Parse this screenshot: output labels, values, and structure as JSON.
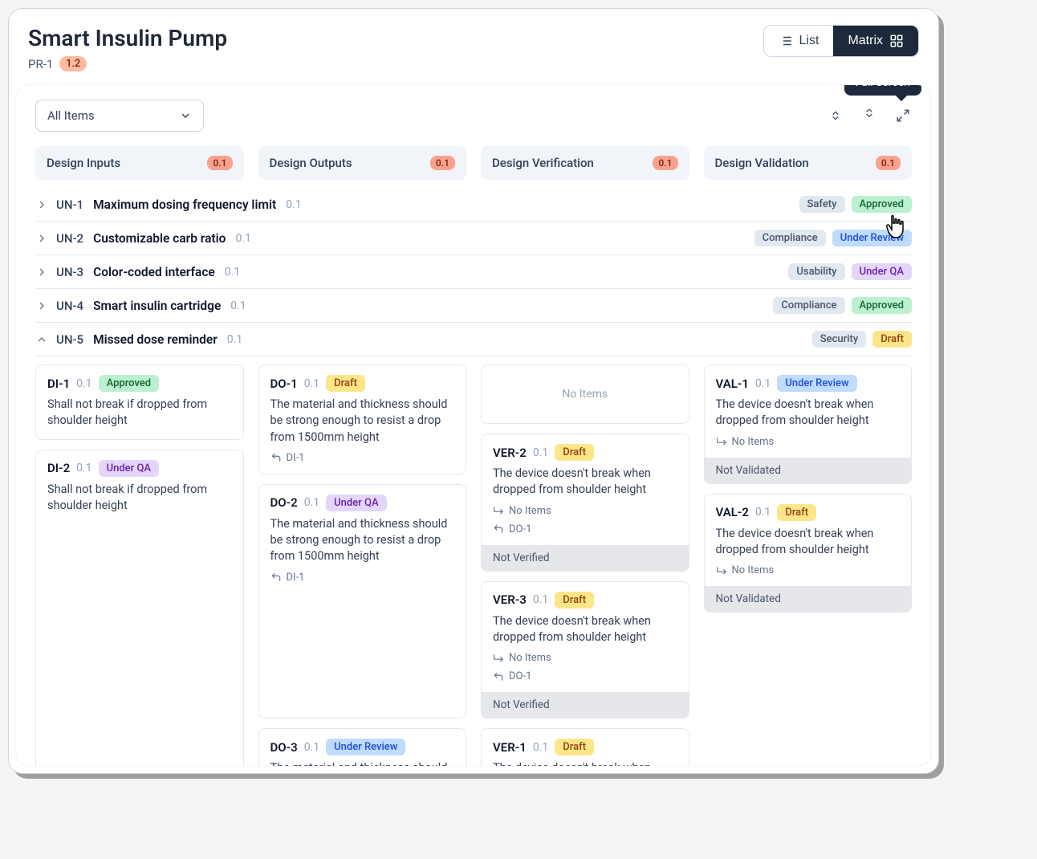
{
  "header": {
    "title": "Smart Insulin Pump",
    "project_id": "PR-1",
    "version": "1.2",
    "view_list": "List",
    "view_matrix": "Matrix"
  },
  "toolbar": {
    "filter_label": "All Items",
    "tooltip_fullscreen": "Full Screen"
  },
  "columns": [
    {
      "title": "Design Inputs",
      "count": "0.1"
    },
    {
      "title": "Design Outputs",
      "count": "0.1"
    },
    {
      "title": "Design Verification",
      "count": "0.1"
    },
    {
      "title": "Design Validation",
      "count": "0.1"
    }
  ],
  "rows": [
    {
      "id": "UN-1",
      "title": "Maximum dosing frequency limit",
      "ver": "0.1",
      "tag1": "Safety",
      "tag1_class": "tag-grey",
      "tag2": "Approved",
      "tag2_class": "tag-green",
      "expanded": false
    },
    {
      "id": "UN-2",
      "title": "Customizable carb ratio",
      "ver": "0.1",
      "tag1": "Compliance",
      "tag1_class": "tag-grey",
      "tag2": "Under Review",
      "tag2_class": "tag-blue",
      "expanded": false
    },
    {
      "id": "UN-3",
      "title": "Color-coded interface",
      "ver": "0.1",
      "tag1": "Usability",
      "tag1_class": "tag-grey",
      "tag2": "Under QA",
      "tag2_class": "tag-purple",
      "expanded": false
    },
    {
      "id": "UN-4",
      "title": "Smart insulin cartridge",
      "ver": "0.1",
      "tag1": "Compliance",
      "tag1_class": "tag-grey",
      "tag2": "Approved",
      "tag2_class": "tag-green",
      "expanded": false
    },
    {
      "id": "UN-5",
      "title": "Missed dose reminder",
      "ver": "0.1",
      "tag1": "Security",
      "tag1_class": "tag-grey",
      "tag2": "Draft",
      "tag2_class": "tag-yellow",
      "expanded": true
    }
  ],
  "labels": {
    "no_items": "No Items",
    "not_verified": "Not Verified",
    "not_validated": "Not Validated"
  },
  "expanded": {
    "design_inputs": [
      {
        "id": "DI-1",
        "ver": "0.1",
        "status": "Approved",
        "status_class": "tag-green",
        "desc": "Shall not break if dropped from shoulder height"
      },
      {
        "id": "DI-2",
        "ver": "0.1",
        "status": "Under QA",
        "status_class": "tag-purple",
        "desc": "Shall not break if dropped from shoulder height"
      }
    ],
    "design_outputs": [
      {
        "id": "DO-1",
        "ver": "0.1",
        "status": "Draft",
        "status_class": "tag-yellow",
        "desc": "The material and thickness should be strong enough to resist a drop from 1500mm height",
        "ref": "DI-1"
      },
      {
        "id": "DO-2",
        "ver": "0.1",
        "status": "Under QA",
        "status_class": "tag-purple",
        "desc": "The material and thickness should be strong enough to resist a drop from 1500mm height",
        "ref": "DI-1"
      },
      {
        "id": "DO-3",
        "ver": "0.1",
        "status": "Under Review",
        "status_class": "tag-blue",
        "desc": "The material and thickness should"
      }
    ],
    "design_verification": [
      {
        "id": "VER-2",
        "ver": "0.1",
        "status": "Draft",
        "status_class": "tag-yellow",
        "desc": "The device doesn't break when dropped from shoulder height",
        "sub_no_items": true,
        "ref": "DO-1",
        "footer": "Not Verified"
      },
      {
        "id": "VER-3",
        "ver": "0.1",
        "status": "Draft",
        "status_class": "tag-yellow",
        "desc": "The device doesn't break when dropped from shoulder height",
        "sub_no_items": true,
        "ref": "DO-1",
        "footer": "Not Verified"
      },
      {
        "id": "VER-1",
        "ver": "0.1",
        "status": "Draft",
        "status_class": "tag-yellow",
        "desc": "The device doesn't break when"
      }
    ],
    "design_validation": [
      {
        "id": "VAL-1",
        "ver": "0.1",
        "status": "Under Review",
        "status_class": "tag-blue",
        "desc": "The device doesn't break when dropped from shoulder height",
        "sub_no_items": true,
        "footer": "Not Validated"
      },
      {
        "id": "VAL-2",
        "ver": "0.1",
        "status": "Draft",
        "status_class": "tag-yellow",
        "desc": "The device doesn't break when dropped from shoulder height",
        "sub_no_items": true,
        "footer": "Not Validated"
      }
    ]
  }
}
